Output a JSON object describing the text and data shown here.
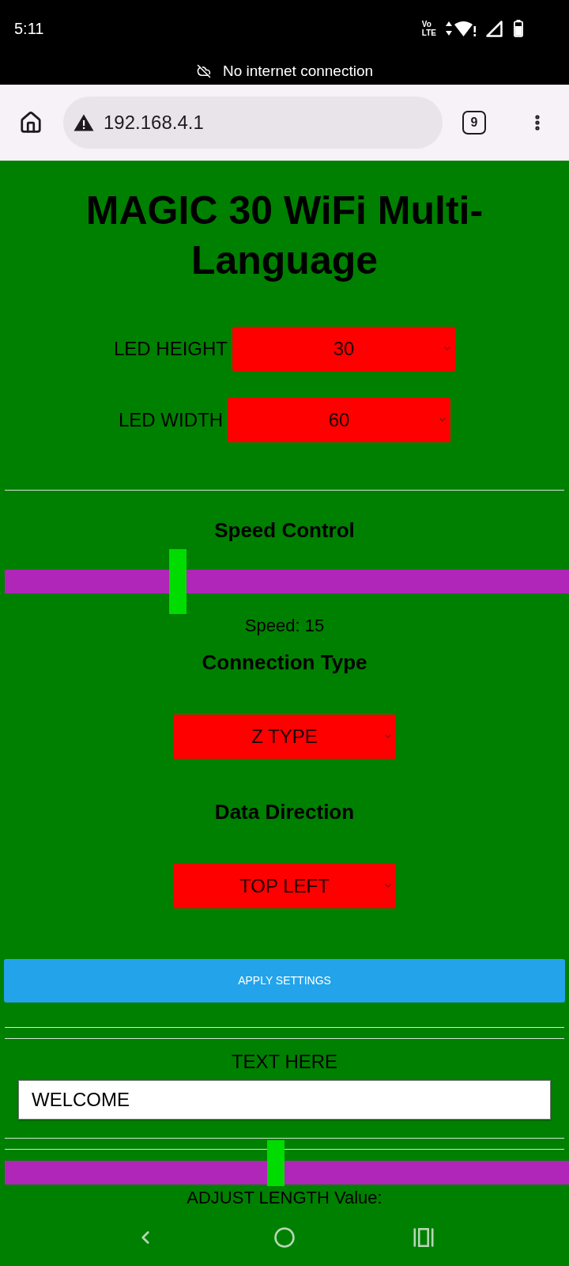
{
  "status_bar": {
    "time": "5:11",
    "volte_top": "Vo",
    "volte_bottom": "LTE",
    "notice": "No internet connection"
  },
  "browser": {
    "url": "192.168.4.1",
    "tab_count": "9"
  },
  "page": {
    "title": "MAGIC 30 WiFi Multi-Language",
    "led_fields": [
      {
        "label": "LED HEIGHT",
        "value": "30"
      },
      {
        "label": "LED WIDTH",
        "value": "60"
      }
    ],
    "speed_control": {
      "heading": "Speed Control",
      "slider": {
        "level": 0.3
      },
      "reading": "Speed: 15"
    },
    "connection_type": {
      "heading": "Connection Type",
      "value": "Z TYPE"
    },
    "data_direction": {
      "heading": "Data Direction",
      "value": "TOP LEFT"
    },
    "apply_button": "APPLY SETTINGS",
    "text_entry": {
      "label": "TEXT HERE",
      "value": "WELCOME"
    },
    "adjust_length": {
      "slider": {
        "level": 0.48
      },
      "reading": "ADJUST LENGTH Value:"
    }
  }
}
